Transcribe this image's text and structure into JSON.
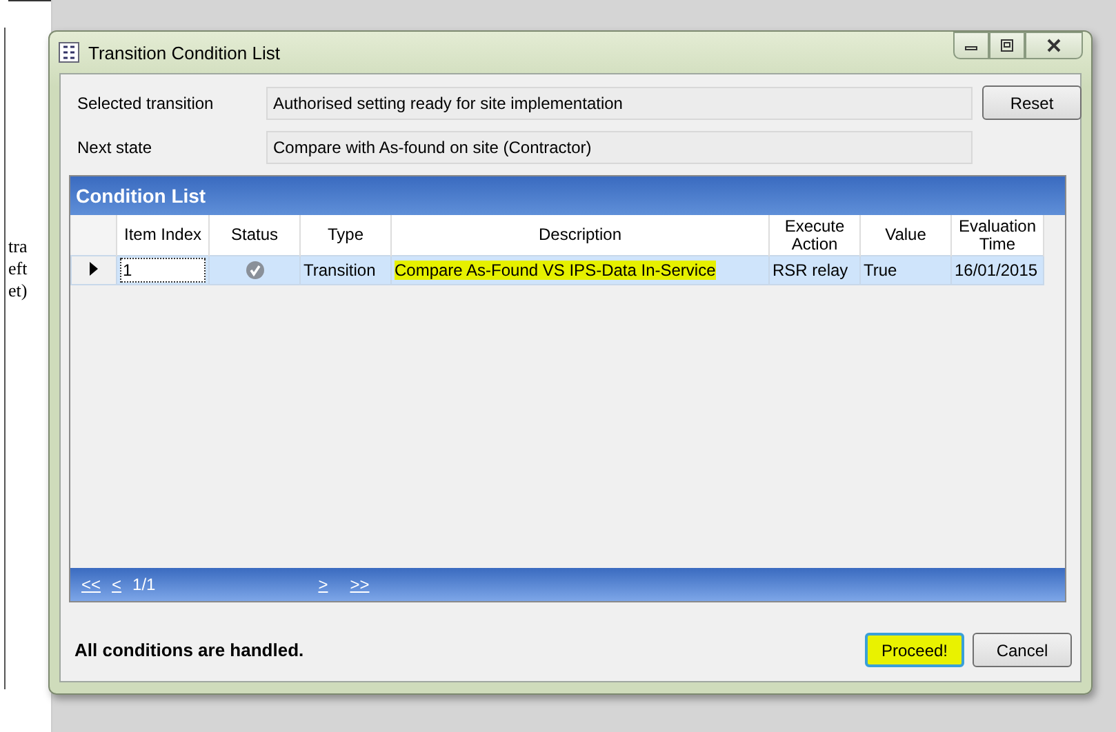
{
  "background_document": {
    "lines": [
      "tra",
      "eft",
      "et)"
    ]
  },
  "window": {
    "title": "Transition Condition List"
  },
  "fields": [
    {
      "label": "Selected transition",
      "value": "Authorised setting ready for site implementation"
    },
    {
      "label": "Next state",
      "value": "Compare with As-found on site (Contractor)"
    }
  ],
  "reset_button": "Reset",
  "condition_list": {
    "title": "Condition List",
    "columns": [
      "Item Index",
      "Status",
      "Type",
      "Description",
      "Execute Action",
      "Value",
      "Evaluation Time"
    ],
    "rows": [
      {
        "selected": true,
        "current": true,
        "item_index": "1",
        "handled": true,
        "type": "Transition",
        "description": "Compare As-Found VS IPS-Data In-Service",
        "description_highlighted": true,
        "execute_action": "RSR relay",
        "value": "True",
        "evaluation_time": "16/01/2015"
      }
    ],
    "pager": {
      "first": "<<",
      "previous": "<",
      "page": "1/1",
      "next": ">",
      "last": ">>"
    }
  },
  "status_message": "All conditions are handled.",
  "buttons": [
    {
      "label": "Proceed!",
      "highlighted": true,
      "focused": true
    },
    {
      "label": "Cancel",
      "highlighted": false,
      "focused": false
    }
  ]
}
